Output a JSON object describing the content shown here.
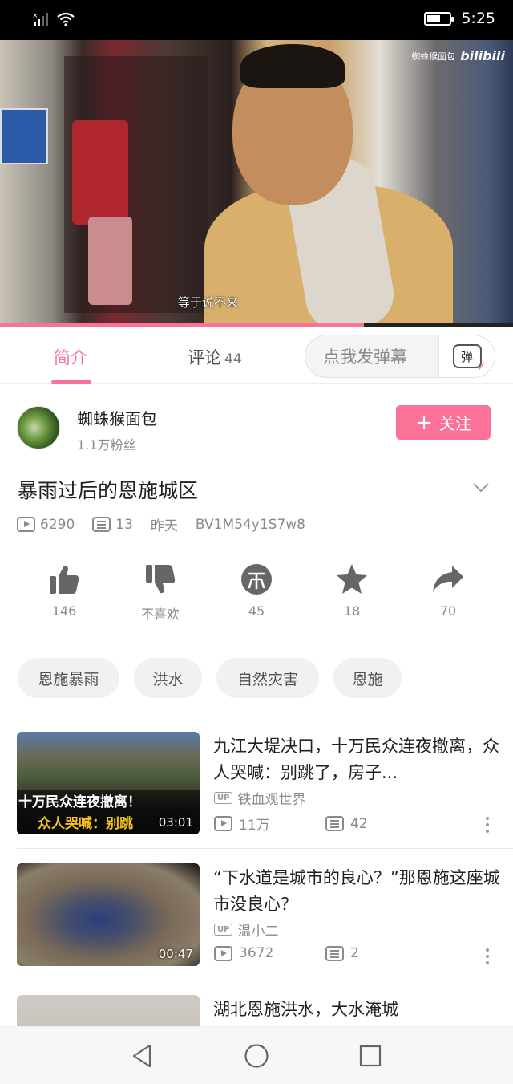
{
  "status_bar": {
    "time": "5:25",
    "icons": [
      "no-sim-icon",
      "wifi-icon",
      "battery-charging-icon"
    ],
    "battery_percent": 60
  },
  "video": {
    "watermark_author": "蜘蛛猴面包",
    "watermark_logo": "bilibili",
    "subtitle": "等于说不来",
    "progress_percent": 71
  },
  "tabs": {
    "intro": "简介",
    "comments": "评论",
    "comment_count": "44",
    "danmaku_placeholder": "点我发弹幕",
    "danmaku_icon_label": "弹"
  },
  "uploader": {
    "name": "蜘蛛猴面包",
    "fans": "1.1万粉丝",
    "follow_label": "关注",
    "follow_icon": "+"
  },
  "video_info": {
    "title": "暴雨过后的恩施城区",
    "views": "6290",
    "danmaku_count": "13",
    "date": "昨天",
    "bvid": "BV1M54y1S7w8"
  },
  "actions": [
    {
      "icon": "thumbs-up-icon",
      "label": "146"
    },
    {
      "icon": "thumbs-down-icon",
      "label": "不喜欢"
    },
    {
      "icon": "coin-icon",
      "label": "45"
    },
    {
      "icon": "star-icon",
      "label": "18"
    },
    {
      "icon": "share-icon",
      "label": "70"
    }
  ],
  "tags": [
    "恩施暴雨",
    "洪水",
    "自然灾害",
    "恩施"
  ],
  "related": [
    {
      "title": "九江大堤决口，十万民众连夜撤离，众人哭喊：别跳了，房子...",
      "up_badge": "UP",
      "uploader": "铁血观世界",
      "views": "11万",
      "danmaku": "42",
      "duration": "03:01",
      "thumb_caption_1": "十万民众连夜撤离！",
      "thumb_caption_2": "众人哭喊：别跳"
    },
    {
      "title": "“下水道是城市的良心？”那恩施这座城市没良心？",
      "up_badge": "UP",
      "uploader": "温小二",
      "views": "3672",
      "danmaku": "2",
      "duration": "00:47"
    },
    {
      "title": "湖北恩施洪水，大水淹城"
    }
  ],
  "nav": [
    "back-icon",
    "home-icon",
    "recents-icon"
  ]
}
